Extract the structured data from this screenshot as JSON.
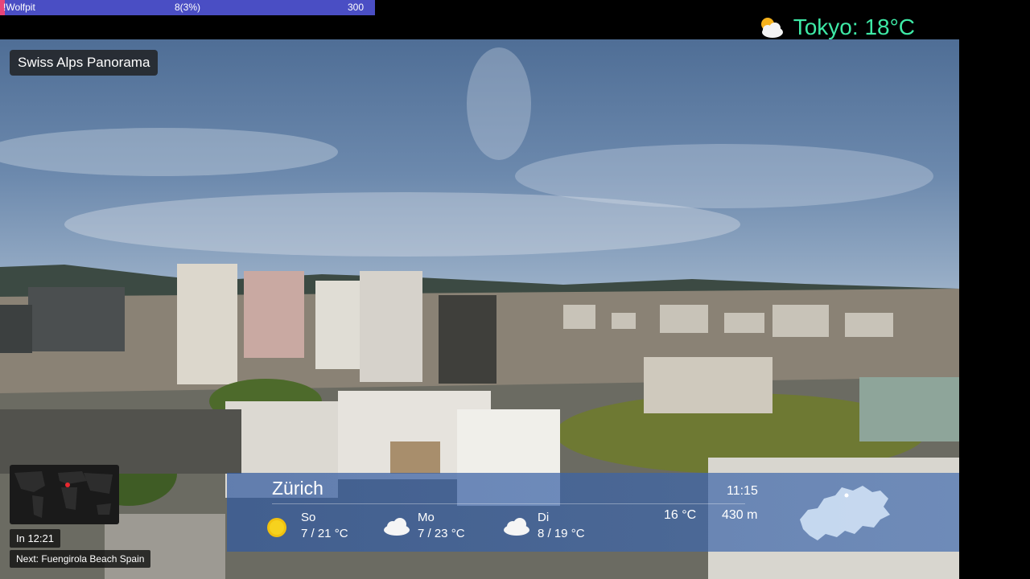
{
  "stream_bar": {
    "name": "!Wolfpit",
    "middle": "8(3%)",
    "right": "300",
    "progress": 0.03
  },
  "tokyo": {
    "label": "Tokyo: 18°C",
    "icon": "sun-behind-cloud-icon"
  },
  "camera": {
    "title": "Swiss Alps Panorama"
  },
  "rotation": {
    "countdown": "In 12:21",
    "next": "Next: Fuengirola Beach Spain"
  },
  "weather": {
    "city": "Zürich",
    "time": "11:15",
    "current_temp": "16 °C",
    "altitude": "430 m",
    "forecast": [
      {
        "day": "So",
        "temps": "7 / 21 °C",
        "icon": "sun-icon"
      },
      {
        "day": "Mo",
        "temps": "7 / 23 °C",
        "icon": "cloud-icon"
      },
      {
        "day": "Di",
        "temps": "8 / 19 °C",
        "icon": "cloud-icon"
      }
    ]
  },
  "colors": {
    "accent_green": "#3ee9a6",
    "bar_blue": "#4a4ec4",
    "bar_pink": "#e6457a"
  }
}
